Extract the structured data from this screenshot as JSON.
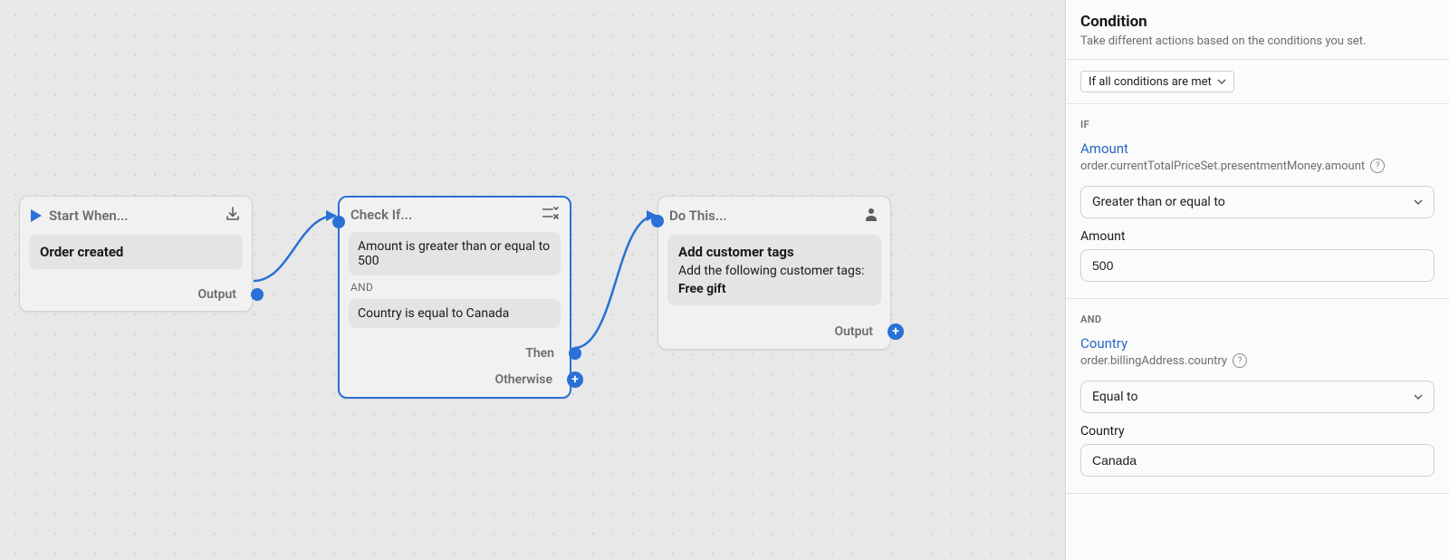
{
  "canvas": {
    "start": {
      "header": "Start When...",
      "event": "Order created",
      "outputLabel": "Output"
    },
    "condition": {
      "header": "Check If...",
      "rule1": "Amount is greater than or equal to 500",
      "joiner": "AND",
      "rule2": "Country is equal to Canada",
      "thenLabel": "Then",
      "otherwiseLabel": "Otherwise"
    },
    "action": {
      "header": "Do This...",
      "title": "Add customer tags",
      "desc": "Add the following customer tags:",
      "tag": "Free gift",
      "outputLabel": "Output"
    }
  },
  "panel": {
    "title": "Condition",
    "subtitle": "Take different actions based on the conditions you set.",
    "matchMode": "If all conditions are met",
    "sections": {
      "if": {
        "label": "If",
        "fieldLink": "Amount",
        "fieldPath": "order.currentTotalPriceSet.presentmentMoney.amount",
        "operator": "Greater than or equal to",
        "valueLabel": "Amount",
        "value": "500"
      },
      "and": {
        "label": "And",
        "fieldLink": "Country",
        "fieldPath": "order.billingAddress.country",
        "operator": "Equal to",
        "valueLabel": "Country",
        "value": "Canada"
      }
    }
  }
}
